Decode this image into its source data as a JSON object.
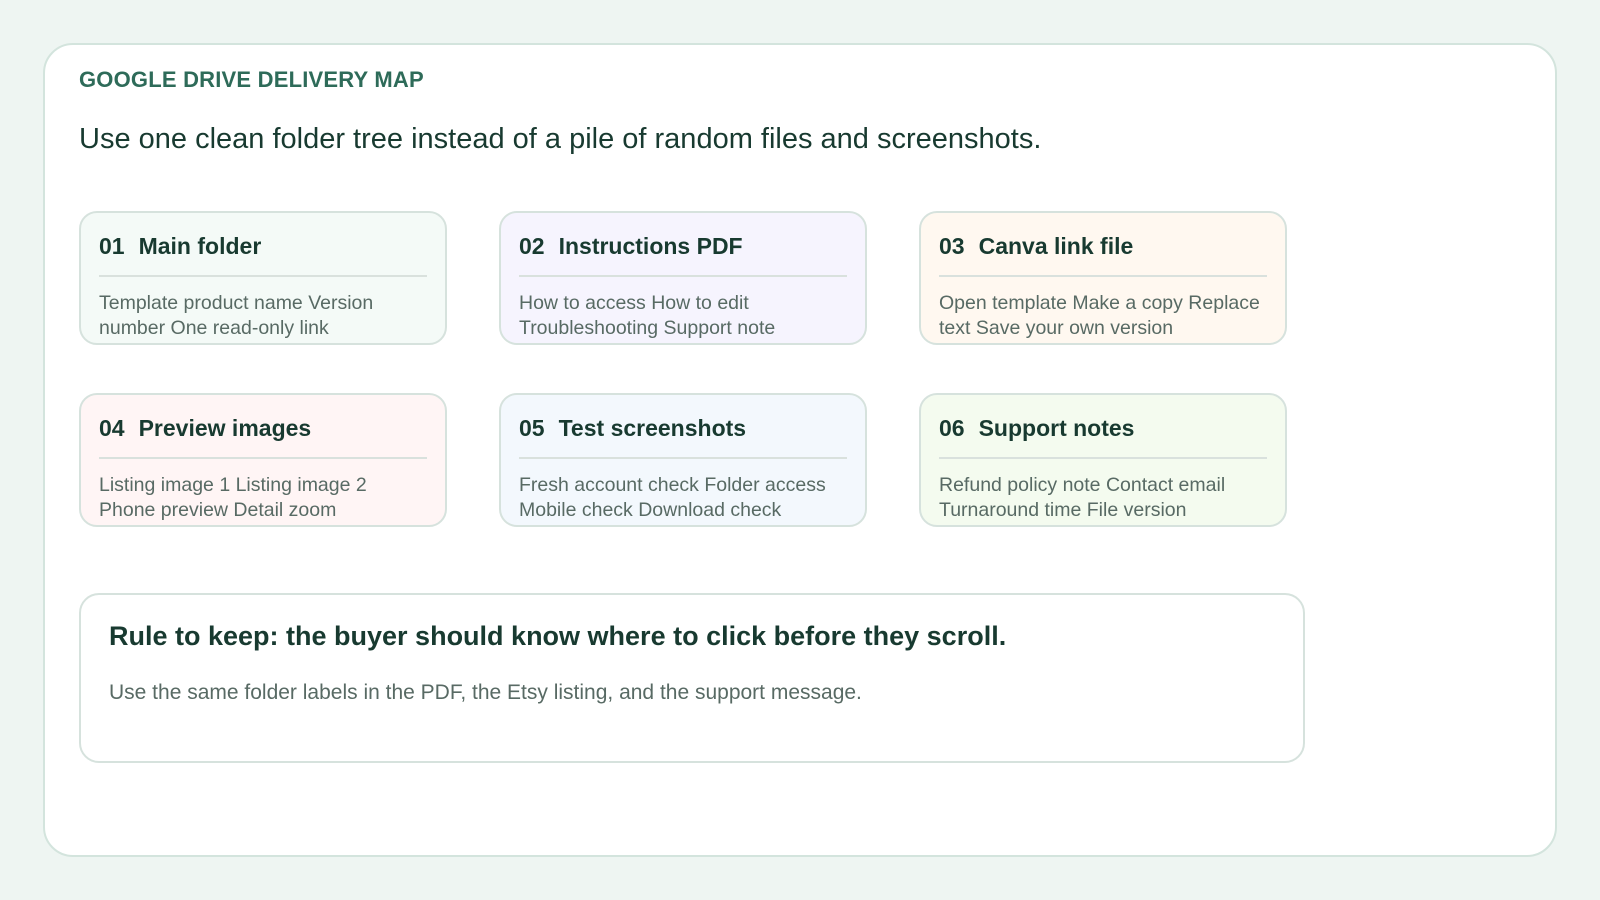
{
  "eyebrow": "GOOGLE DRIVE DELIVERY MAP",
  "headline": "Use one clean folder tree instead of a pile of random files and screenshots.",
  "cards": [
    {
      "num": "01",
      "title": "Main folder",
      "body": "Template product name Version number One read-only link",
      "bg": "#f4faf7"
    },
    {
      "num": "02",
      "title": "Instructions PDF",
      "body": "How to access How to edit Troubleshooting Support note",
      "bg": "#f6f4fe"
    },
    {
      "num": "03",
      "title": "Canva link file",
      "body": "Open template Make a copy Replace text Save your own version",
      "bg": "#fff8f0"
    },
    {
      "num": "04",
      "title": "Preview images",
      "body": "Listing image 1 Listing image 2 Phone preview Detail zoom",
      "bg": "#fff5f5"
    },
    {
      "num": "05",
      "title": "Test screenshots",
      "body": "Fresh account check Folder access Mobile check Download check",
      "bg": "#f3f8fd"
    },
    {
      "num": "06",
      "title": "Support notes",
      "body": "Refund policy note Contact email Turnaround time File version",
      "bg": "#f4fbef"
    }
  ],
  "rule": {
    "title": "Rule to keep: the buyer should know where to click before they scroll.",
    "body": "Use the same folder labels in the PDF, the Etsy listing, and the support message."
  },
  "colors": {
    "accent": "#2e6b59",
    "text_dark": "#183a30",
    "text_muted": "#586a64",
    "page_bg": "#eef5f2"
  }
}
